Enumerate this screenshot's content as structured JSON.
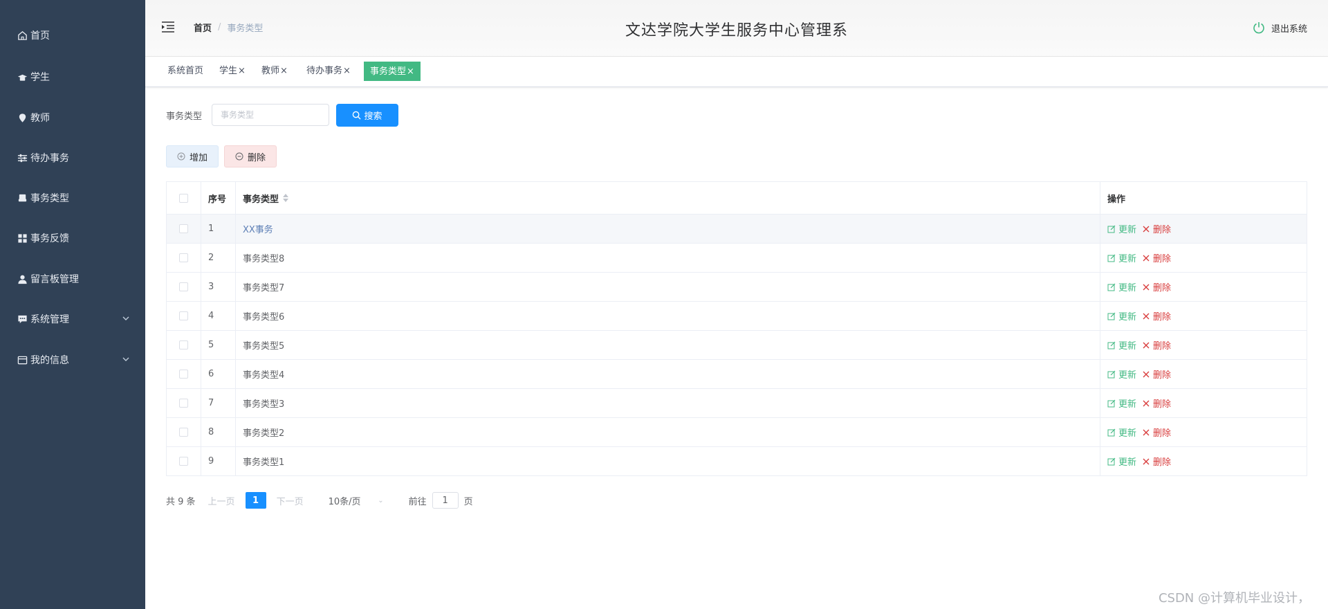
{
  "sidebar": {
    "items": [
      {
        "label": "首页",
        "icon": "home-icon"
      },
      {
        "label": "学生",
        "icon": "student-icon"
      },
      {
        "label": "教师",
        "icon": "location-icon"
      },
      {
        "label": "待办事务",
        "icon": "sliders-icon"
      },
      {
        "label": "事务类型",
        "icon": "printer-icon"
      },
      {
        "label": "事务反馈",
        "icon": "grid-icon"
      },
      {
        "label": "留言板管理",
        "icon": "user-icon"
      },
      {
        "label": "系统管理",
        "icon": "chat-icon"
      },
      {
        "label": "我的信息",
        "icon": "window-icon"
      }
    ]
  },
  "header": {
    "title": "文达学院大学生服务中心管理系",
    "breadcrumb": {
      "home": "首页",
      "separator": "/",
      "current": "事务类型"
    },
    "logout": "退出系统"
  },
  "tags": [
    {
      "label": "系统首页",
      "closable": false,
      "active": false
    },
    {
      "label": "学生",
      "closable": true,
      "active": false
    },
    {
      "label": "教师",
      "closable": true,
      "active": false
    },
    {
      "label": "待办事务",
      "closable": true,
      "active": false
    },
    {
      "label": "事务类型",
      "closable": true,
      "active": true
    }
  ],
  "tag_close_glyph": "×",
  "search": {
    "label": "事务类型",
    "placeholder": "事务类型",
    "value": "",
    "button": "搜索"
  },
  "actions": {
    "add": "增加",
    "delete": "删除"
  },
  "table": {
    "headers": {
      "index": "序号",
      "type": "事务类型",
      "ops": "操作"
    },
    "rows": [
      {
        "index": "1",
        "type": "XX事务"
      },
      {
        "index": "2",
        "type": "事务类型8"
      },
      {
        "index": "3",
        "type": "事务类型7"
      },
      {
        "index": "4",
        "type": "事务类型6"
      },
      {
        "index": "5",
        "type": "事务类型5"
      },
      {
        "index": "6",
        "type": "事务类型4"
      },
      {
        "index": "7",
        "type": "事务类型3"
      },
      {
        "index": "8",
        "type": "事务类型2"
      },
      {
        "index": "9",
        "type": "事务类型1"
      }
    ],
    "edit_label": "更新",
    "delete_label": "删除"
  },
  "pagination": {
    "total": "共 9 条",
    "prev": "上一页",
    "current": "1",
    "next": "下一页",
    "page_size": "10条/页",
    "goto_prefix": "前往",
    "goto_value": "1",
    "goto_suffix": "页"
  },
  "watermark": "CSDN @计算机毕业设计，",
  "colors": {
    "sidebar_bg": "#304156",
    "primary": "#1890ff",
    "active_tag": "#42b983",
    "edit": "#42b983",
    "delete": "#d83c3c"
  }
}
